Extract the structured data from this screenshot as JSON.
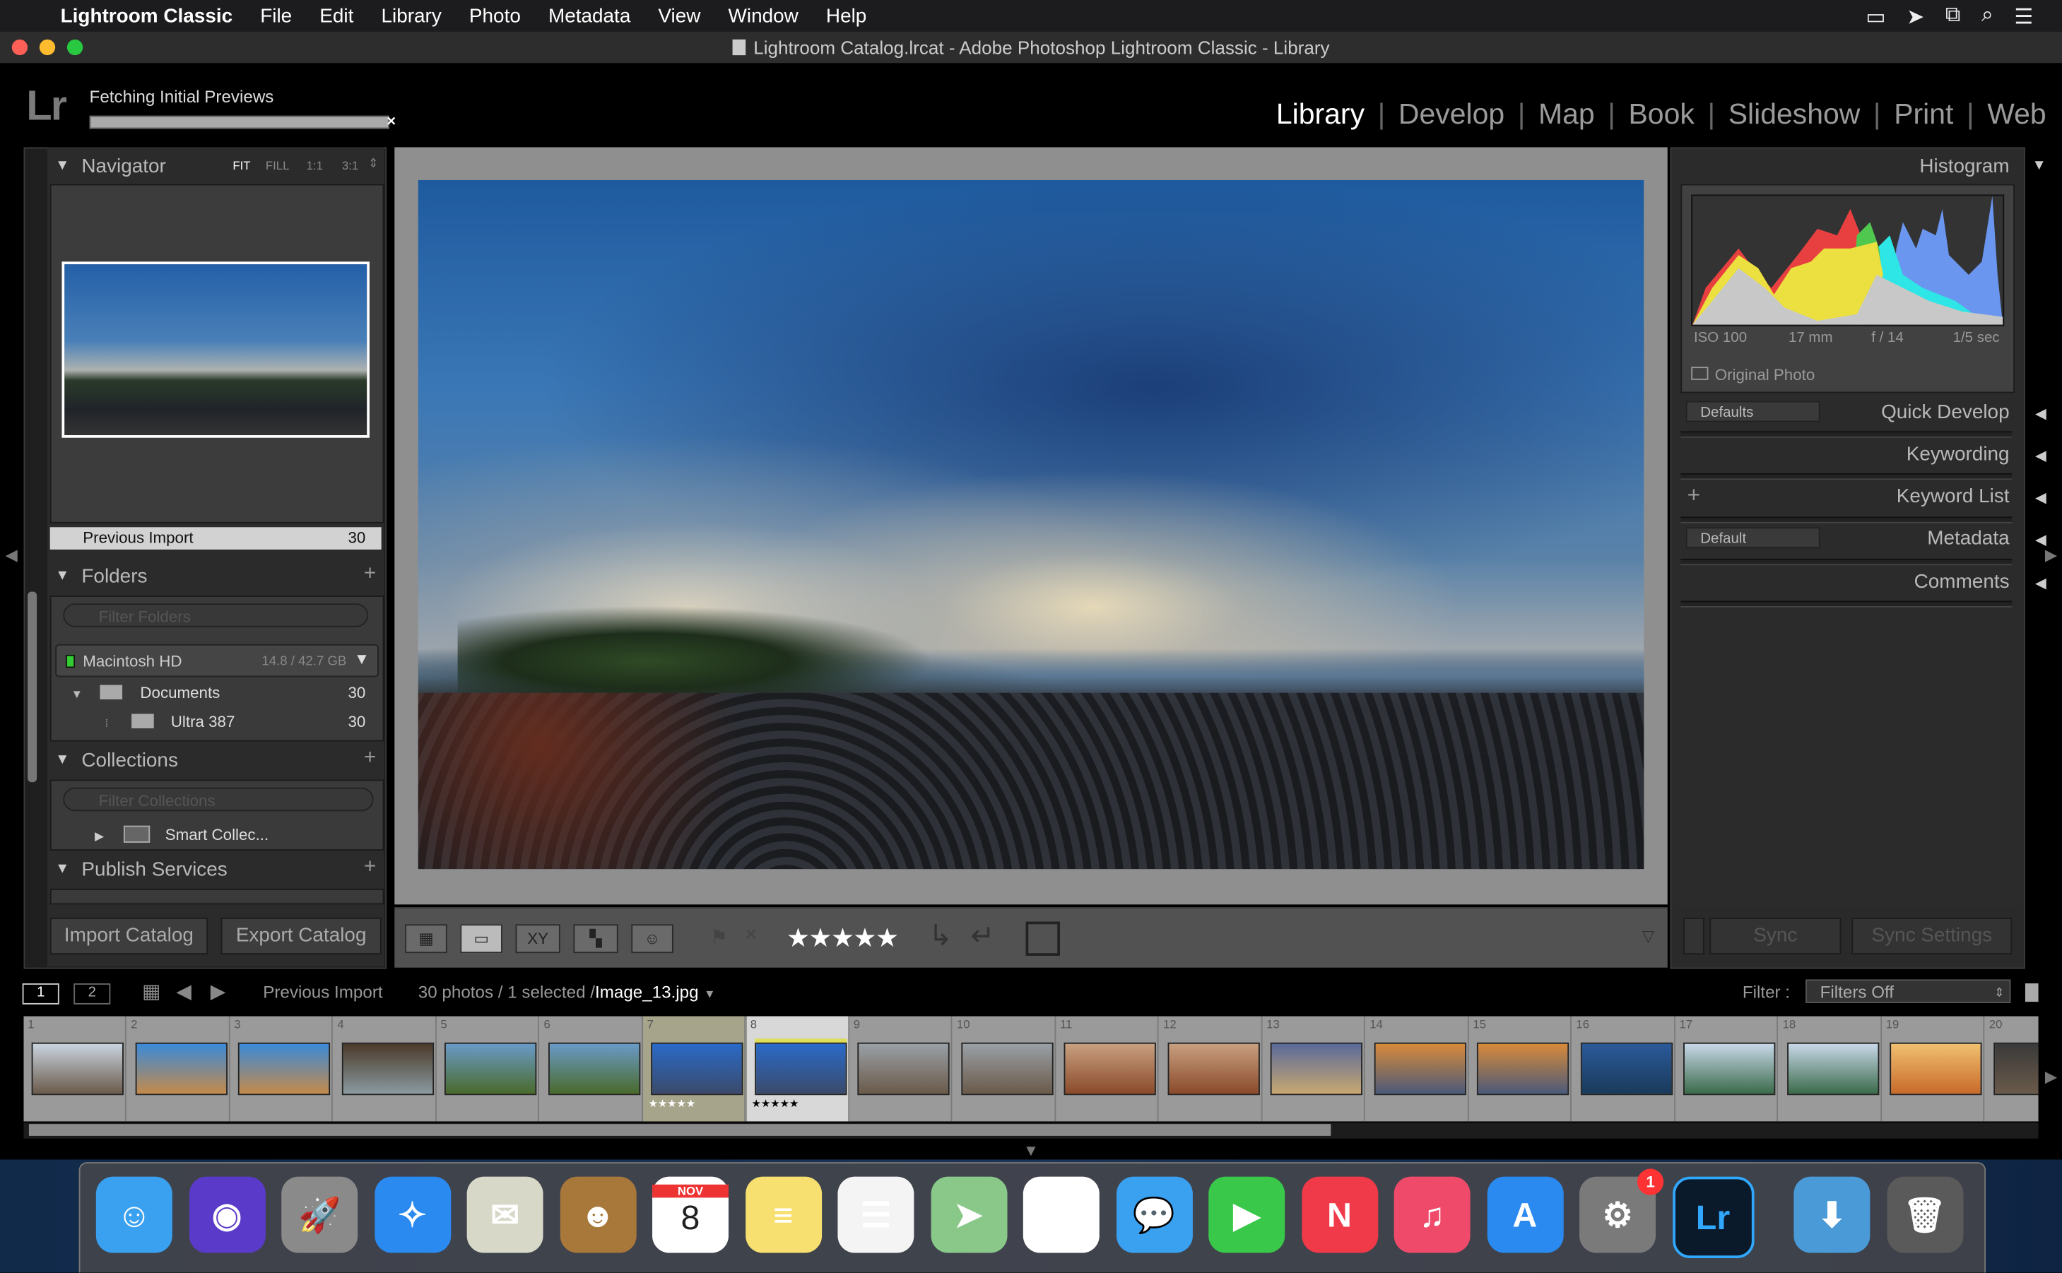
{
  "menubar": {
    "apple": "",
    "app": "Lightroom Classic",
    "items": [
      "File",
      "Edit",
      "Library",
      "Photo",
      "Metadata",
      "View",
      "Window",
      "Help"
    ],
    "icons": [
      "display-mirroring-icon",
      "location-icon",
      "screen-icon",
      "search-icon",
      "menu-list-icon"
    ]
  },
  "window": {
    "title": "Lightroom Catalog.lrcat - Adobe Photoshop Lightroom Classic - Library"
  },
  "identity": {
    "logo": "Lr",
    "status": "Fetching Initial Previews",
    "progress_percent": 100,
    "cancel": "×"
  },
  "modules": [
    {
      "label": "Library",
      "active": true
    },
    {
      "label": "Develop"
    },
    {
      "label": "Map"
    },
    {
      "label": "Book"
    },
    {
      "label": "Slideshow"
    },
    {
      "label": "Print"
    },
    {
      "label": "Web"
    }
  ],
  "navigator": {
    "title": "Navigator",
    "zoom_options": [
      "FIT",
      "FILL",
      "1:1",
      "3:1"
    ],
    "active_zoom": "FIT"
  },
  "catalog": {
    "previous_import": "Previous Import",
    "previous_import_count": "30"
  },
  "folders": {
    "title": "Folders",
    "filter_placeholder": "Filter Folders",
    "volume": {
      "name": "Macintosh HD",
      "space": "14.8 / 42.7 GB"
    },
    "items": [
      {
        "name": "Documents",
        "count": "30"
      },
      {
        "name": "Ultra 387",
        "count": "30"
      }
    ]
  },
  "collections": {
    "title": "Collections",
    "filter_placeholder": "Filter Collections",
    "items": [
      {
        "name": "Smart Collec..."
      }
    ]
  },
  "publish": {
    "title": "Publish Services"
  },
  "left_buttons": {
    "import": "Import Catalog",
    "export": "Export Catalog"
  },
  "toolbar": {
    "stars": "★★★★★",
    "view_modes": [
      "grid-view-icon",
      "loupe-view-icon",
      "compare-view-icon",
      "survey-view-icon",
      "people-view-icon"
    ],
    "compare_label": "XY"
  },
  "histogram": {
    "title": "Histogram",
    "iso": "ISO 100",
    "focal": "17 mm",
    "aperture": "f / 14",
    "shutter": "1/5 sec",
    "original_photo": "Original Photo"
  },
  "right_panels": {
    "quick_develop": "Quick Develop",
    "quick_develop_preset": "Defaults",
    "keywording": "Keywording",
    "keyword_list": "Keyword List",
    "metadata": "Metadata",
    "metadata_preset": "Default",
    "comments": "Comments"
  },
  "sync": {
    "sync": "Sync",
    "sync_settings": "Sync Settings"
  },
  "filmstrip_bar": {
    "screen1": "1",
    "screen2": "2",
    "source": "Previous Import",
    "info": "30 photos / 1 selected /",
    "filename": "Image_13.jpg",
    "filter_label": "Filter :",
    "filter_value": "Filters Off"
  },
  "filmstrip": {
    "cells": [
      {
        "num": "1",
        "colors": [
          "#c9d4df",
          "#6a5a4a"
        ]
      },
      {
        "num": "2",
        "colors": [
          "#3a8ad8",
          "#c58a4a"
        ]
      },
      {
        "num": "3",
        "colors": [
          "#3a8ad8",
          "#c58a4a"
        ]
      },
      {
        "num": "4",
        "colors": [
          "#4a3a2a",
          "#8a9aa0"
        ]
      },
      {
        "num": "5",
        "colors": [
          "#6a9ac8",
          "#4a6a2a"
        ]
      },
      {
        "num": "6",
        "colors": [
          "#6a9ac8",
          "#4a6a2a"
        ]
      },
      {
        "num": "7",
        "colors": [
          "#2a6ac8",
          "#3a4a6a"
        ],
        "rating": "★★★★★",
        "state": "highlighted"
      },
      {
        "num": "8",
        "colors": [
          "#2a6ac8",
          "#3a4a6a"
        ],
        "rating": "★★★★★",
        "state": "selected"
      },
      {
        "num": "9",
        "colors": [
          "#9aa0a6",
          "#6a5a4a"
        ]
      },
      {
        "num": "10",
        "colors": [
          "#9aa0a6",
          "#6a5a4a"
        ]
      },
      {
        "num": "11",
        "colors": [
          "#c8a080",
          "#8a4a2a"
        ]
      },
      {
        "num": "12",
        "colors": [
          "#c8a080",
          "#8a4a2a"
        ]
      },
      {
        "num": "13",
        "colors": [
          "#5a6a9a",
          "#c8a870"
        ]
      },
      {
        "num": "14",
        "colors": [
          "#d88a3a",
          "#4a5a7a"
        ]
      },
      {
        "num": "15",
        "colors": [
          "#d88a3a",
          "#4a5a7a"
        ]
      },
      {
        "num": "16",
        "colors": [
          "#2a5a9a",
          "#1a3a5a"
        ]
      },
      {
        "num": "17",
        "colors": [
          "#c8d8e8",
          "#3a6a4a"
        ]
      },
      {
        "num": "18",
        "colors": [
          "#c8d8e8",
          "#3a6a4a"
        ]
      },
      {
        "num": "19",
        "colors": [
          "#f0c070",
          "#c86a2a"
        ]
      },
      {
        "num": "20",
        "colors": [
          "#3a3a3a",
          "#6a5a4a"
        ]
      }
    ]
  },
  "dock": {
    "apps": [
      {
        "name": "finder",
        "bg": "#3aa0f0",
        "glyph": "☺"
      },
      {
        "name": "siri",
        "bg": "#5a3ac8",
        "glyph": "◉"
      },
      {
        "name": "launchpad",
        "bg": "#8a8a8a",
        "glyph": "🚀"
      },
      {
        "name": "safari",
        "bg": "#2a8af0",
        "glyph": "✧"
      },
      {
        "name": "mail",
        "bg": "#d8d8c8",
        "glyph": "✉"
      },
      {
        "name": "contacts",
        "bg": "#a8783a",
        "glyph": "☻"
      },
      {
        "name": "calendar",
        "bg": "#ffffff",
        "month": "NOV",
        "day": "8"
      },
      {
        "name": "notes",
        "bg": "#f8e070",
        "glyph": "≡"
      },
      {
        "name": "reminders",
        "bg": "#f4f4f4",
        "glyph": "☰"
      },
      {
        "name": "maps",
        "bg": "#8ac88a",
        "glyph": "➤"
      },
      {
        "name": "photos",
        "bg": "#ffffff",
        "glyph": "✿"
      },
      {
        "name": "messages",
        "bg": "#3aa0f0",
        "glyph": "💬"
      },
      {
        "name": "facetime",
        "bg": "#3ac84a",
        "glyph": "▶"
      },
      {
        "name": "news",
        "bg": "#f03a4a",
        "glyph": "N"
      },
      {
        "name": "music",
        "bg": "#f04a6a",
        "glyph": "♫"
      },
      {
        "name": "app-store",
        "bg": "#2a8af0",
        "glyph": "A"
      },
      {
        "name": "system-preferences",
        "bg": "#7a7a7a",
        "glyph": "⚙",
        "badge": "1"
      },
      {
        "name": "lightroom",
        "bg": "#0a1a2a",
        "glyph": "Lr"
      },
      {
        "name": "downloads",
        "bg": "#4a9ad8",
        "glyph": "⬇"
      },
      {
        "name": "trash",
        "bg": "#5a5a5a",
        "glyph": "🗑"
      }
    ]
  },
  "colors": {
    "accent_selected": "#d8d8d8",
    "highlight": "#a6a48a",
    "lr_blue": "#31a8ff"
  }
}
